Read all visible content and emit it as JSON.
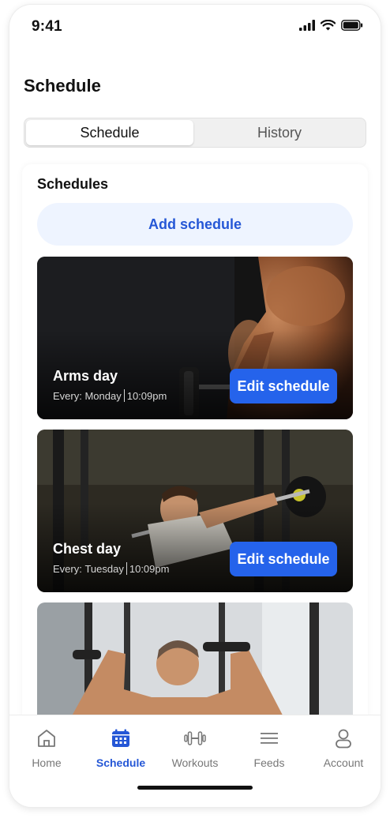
{
  "status_bar": {
    "time": "9:41"
  },
  "page": {
    "title": "Schedule"
  },
  "segmented": {
    "active": "Schedule",
    "inactive": "History"
  },
  "schedules": {
    "heading": "Schedules",
    "add_label": "Add schedule",
    "items": [
      {
        "name": "Arms day",
        "every_label": "Every:",
        "day": "Monday",
        "time": "10:09pm",
        "edit_label": "Edit schedule"
      },
      {
        "name": "Chest day",
        "every_label": "Every:",
        "day": "Tuesday",
        "time": "10:09pm",
        "edit_label": "Edit schedule"
      }
    ]
  },
  "tabbar": {
    "items": [
      {
        "label": "Home",
        "icon": "home-icon"
      },
      {
        "label": "Schedule",
        "icon": "calendar-icon"
      },
      {
        "label": "Workouts",
        "icon": "dumbbell-icon"
      },
      {
        "label": "Feeds",
        "icon": "menu-lines-icon"
      },
      {
        "label": "Account",
        "icon": "user-icon"
      }
    ],
    "active_index": 1
  },
  "colors": {
    "accent": "#2563eb",
    "accent_text": "#2557d6",
    "add_bg": "#eef4ff"
  }
}
